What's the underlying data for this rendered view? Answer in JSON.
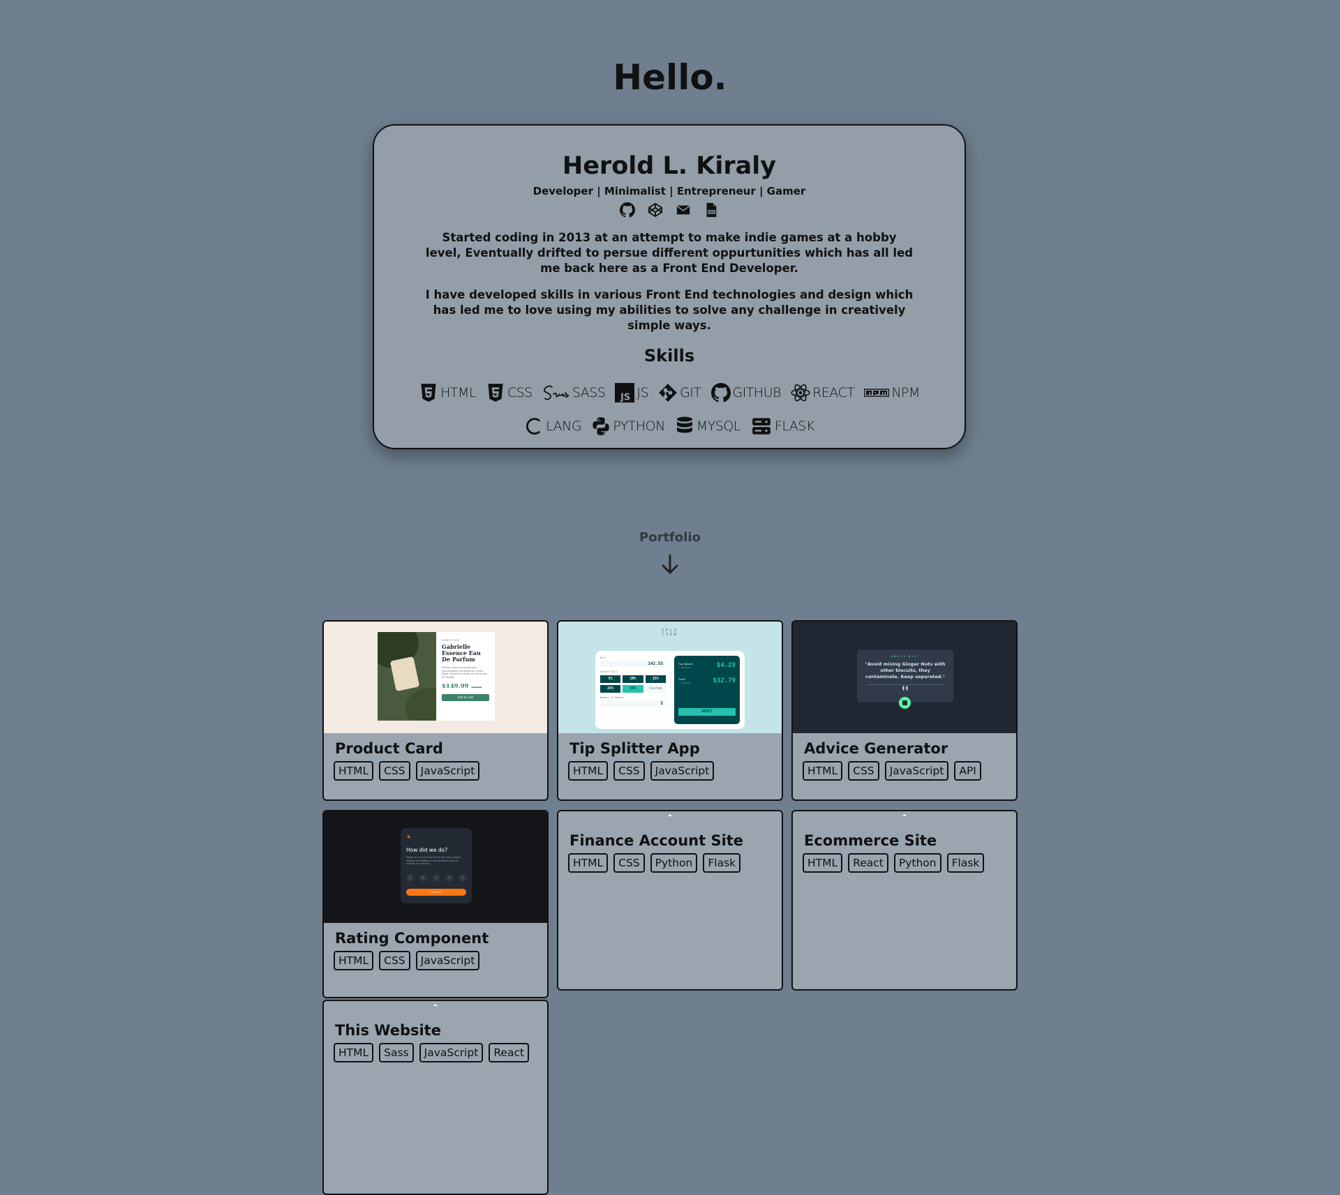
{
  "greeting": "Hello.",
  "profile": {
    "name": "Herold L. Kiraly",
    "tagline": "Developer | Minimalist | Entrepreneur | Gamer",
    "contact_icons": [
      "github-icon",
      "codepen-icon",
      "envelope-icon",
      "pdf-icon"
    ],
    "bio": [
      "Started coding in 2013 at an attempt to make indie games at a hobby level, Eventually drifted to persue different oppurtunities which has all led me back here as a Front End Developer.",
      "I have developed skills in various Front End technologies and design which has led me to love using my abilities to solve any challenge in creatively simple ways."
    ],
    "skills_title": "Skills",
    "skills": [
      {
        "label": "HTML",
        "icon": "html5-icon"
      },
      {
        "label": "CSS",
        "icon": "css3-icon"
      },
      {
        "label": "SASS",
        "icon": "sass-icon"
      },
      {
        "label": "JS",
        "icon": "js-icon"
      },
      {
        "label": "GIT",
        "icon": "git-icon"
      },
      {
        "label": "GITHUB",
        "icon": "github-icon"
      },
      {
        "label": "REACT",
        "icon": "react-icon"
      },
      {
        "label": "NPM",
        "icon": "npm-icon"
      },
      {
        "label": "LANG",
        "icon": "c-icon"
      },
      {
        "label": "PYTHON",
        "icon": "python-icon"
      },
      {
        "label": "MYSQL",
        "icon": "database-icon"
      },
      {
        "label": "FLASK",
        "icon": "server-icon"
      }
    ]
  },
  "portfolio": {
    "label": "Portfolio",
    "projects": [
      {
        "title": "Product Card",
        "tags": [
          "HTML",
          "CSS",
          "JavaScript"
        ]
      },
      {
        "title": "Tip Splitter App",
        "tags": [
          "HTML",
          "CSS",
          "JavaScript"
        ]
      },
      {
        "title": "Advice Generator",
        "tags": [
          "HTML",
          "CSS",
          "JavaScript",
          "API"
        ]
      },
      {
        "title": "Rating Component",
        "tags": [
          "HTML",
          "CSS",
          "JavaScript"
        ]
      },
      {
        "title": "Finance Account Site",
        "tags": [
          "HTML",
          "CSS",
          "Python",
          "Flask"
        ]
      },
      {
        "title": "Ecommerce Site",
        "tags": [
          "HTML",
          "React",
          "Python",
          "Flask"
        ]
      },
      {
        "title": "This Website",
        "tags": [
          "HTML",
          "Sass",
          "JavaScript",
          "React"
        ]
      }
    ],
    "thumbnails": {
      "product_card": {
        "category": "PERFUME",
        "name": "Gabrielle Essence Eau De Parfum",
        "description": "A floral, solar and voluptuous interpretation composed by Olivier Polge, Perfumer-Creator for the House of CHANEL.",
        "price": "$149.99",
        "old_price": "$169.99",
        "button": "Add to Cart"
      },
      "tip_splitter": {
        "logo_line1": "SPLI",
        "logo_line2": "TTER",
        "bill_label": "Bill",
        "bill_value": "142.55",
        "tip_label": "Select Tip %",
        "tip_options": [
          "5%",
          "10%",
          "15%",
          "25%",
          "50%",
          "Custom"
        ],
        "people_label": "Number of People",
        "people_value": "5",
        "tip_amount_label": "Tip Amount",
        "tip_amount_sub": "/ person",
        "tip_amount_value": "$4.28",
        "total_label": "Total",
        "total_sub": "/ person",
        "total_value": "$32.79",
        "reset": "RESET"
      },
      "advice": {
        "heading": "ADVICE #117",
        "quote": "\"Avoid mixing Ginger Nuts with other biscuits, they contaminate. Keep separated.\""
      },
      "rating": {
        "question": "How did we do?",
        "body": "Please let us know how we did with your support request. All feedback is appreciated to help us improve our offering!",
        "numbers": [
          "1",
          "2",
          "3",
          "4",
          "5"
        ],
        "submit": "SUBMIT"
      }
    }
  }
}
